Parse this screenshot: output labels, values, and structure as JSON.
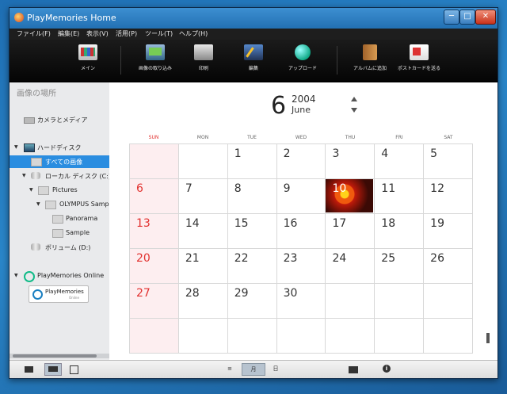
{
  "window": {
    "title": "PlayMemories Home",
    "min_label": "─",
    "max_label": "□",
    "close_label": "✕"
  },
  "menu": [
    "ファイル(F)",
    "編集(E)",
    "表示(V)",
    "活用(P)",
    "ツール(T)",
    "ヘルプ(H)"
  ],
  "toolbar": [
    {
      "label": "メイン",
      "icon": "main-view-icon"
    },
    {
      "label": "画像の取り込み",
      "icon": "import-icon"
    },
    {
      "label": "印刷",
      "icon": "printer-icon"
    },
    {
      "label": "編集",
      "icon": "edit-icon"
    },
    {
      "label": "アップロード",
      "icon": "upload-globe-icon"
    },
    {
      "label": "アルバムに追加",
      "icon": "album-icon"
    },
    {
      "label": "ポストカードを送る",
      "icon": "postcard-icon"
    }
  ],
  "sidebar": {
    "heading": "画像の場所",
    "camera_media": "カメラとメディア",
    "hard_disk": "ハードディスク",
    "all_images": "すべての画像",
    "local_disk": "ローカル ディスク (C:)",
    "pictures": "Pictures",
    "olympus": "OLYMPUS Sample",
    "panorama": "Panorama",
    "sample": "Sample",
    "volume_d": "ボリューム (D:)",
    "online": "PlayMemories Online",
    "logo_text": "PlayMemories",
    "logo_sub": "Online"
  },
  "calendar": {
    "month_num": "6",
    "year": "2004",
    "month_name": "June",
    "days": [
      "SUN",
      "MON",
      "TUE",
      "WED",
      "THU",
      "FRI",
      "SAT"
    ],
    "weeks": [
      [
        "",
        "",
        "1",
        "2",
        "3",
        "4",
        "5"
      ],
      [
        "6",
        "7",
        "8",
        "9",
        "10",
        "11",
        "12"
      ],
      [
        "13",
        "14",
        "15",
        "16",
        "17",
        "18",
        "19"
      ],
      [
        "20",
        "21",
        "22",
        "23",
        "24",
        "25",
        "26"
      ],
      [
        "27",
        "28",
        "29",
        "30",
        "",
        "",
        ""
      ],
      [
        "",
        "",
        "",
        "",
        "",
        "",
        ""
      ]
    ],
    "photo_day": "10"
  },
  "statusbar": {
    "view_all": "≡",
    "view_month": "月",
    "view_day": "日"
  },
  "colors": {
    "accent": "#2a8de0",
    "sunday": "#e2312f",
    "toolbar_bg": "#111111",
    "sidebar_bg": "#e9eaec"
  }
}
